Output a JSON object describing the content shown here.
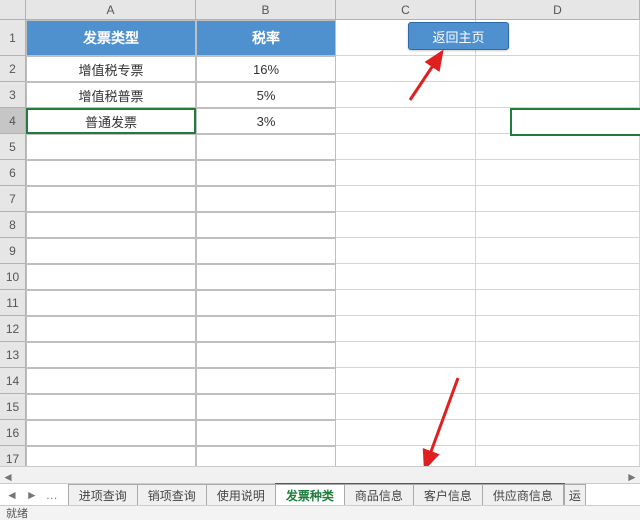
{
  "columns": [
    "A",
    "B",
    "C",
    "D"
  ],
  "row_count": 17,
  "active_row": 4,
  "header": {
    "A": "发票类型",
    "B": "税率"
  },
  "data_rows": [
    {
      "A": "增值税专票",
      "B": "16%"
    },
    {
      "A": "增值税普票",
      "B": "5%"
    },
    {
      "A": "普通发票",
      "B": "3%"
    }
  ],
  "home_button": "返回主页",
  "tabs": {
    "nav": [
      "◄",
      "►",
      "…"
    ],
    "left": [
      "进项查询",
      "销项查询",
      "使用说明"
    ],
    "active": "发票种类",
    "highlighted": [
      "商品信息",
      "客户信息",
      "供应商信息"
    ],
    "overflow": "运"
  },
  "status": "就绪",
  "colors": {
    "accent": "#4f90cf",
    "green": "#1f7e3b",
    "arrow": "#e02020"
  }
}
